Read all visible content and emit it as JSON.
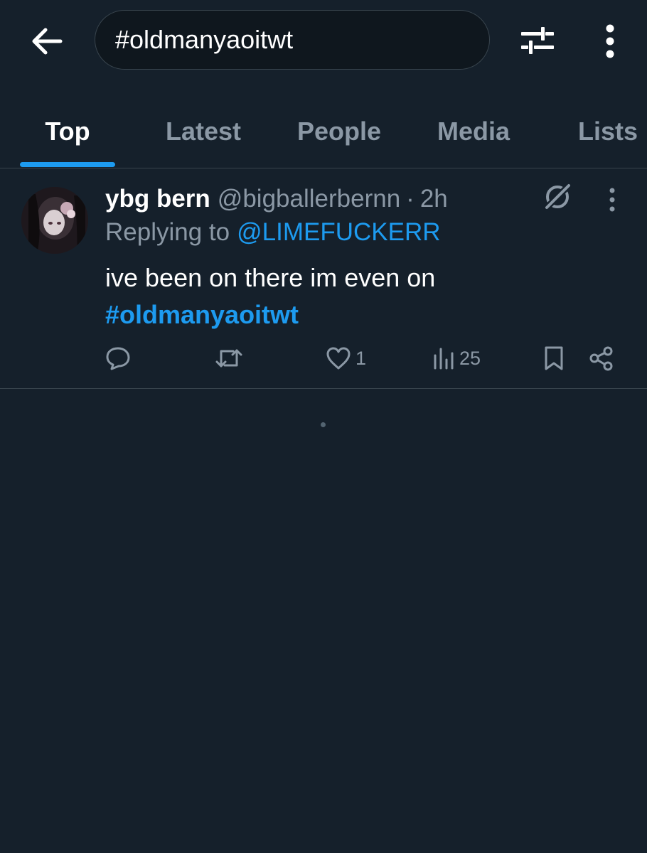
{
  "search": {
    "query": "#oldmanyaoitwt"
  },
  "tabs": [
    {
      "label": "Top"
    },
    {
      "label": "Latest"
    },
    {
      "label": "People"
    },
    {
      "label": "Media"
    },
    {
      "label": "Lists"
    }
  ],
  "active_tab": "Top",
  "tweet": {
    "display_name": "ybg bern",
    "handle": "@bigballerbernn",
    "separator": "·",
    "time": "2h",
    "reply_prefix": "Replying to",
    "reply_to": "@LIMEFUCKERR",
    "text": "ive been on there im even on",
    "hashtag": "#oldmanyaoitwt",
    "likes": "1",
    "views": "25"
  },
  "icons": {
    "back": "back-arrow-icon",
    "filter": "filter-sliders-icon",
    "more": "more-vertical-icon",
    "grok": "grok-icon",
    "reply": "reply-icon",
    "retweet": "retweet-icon",
    "like": "heart-icon",
    "views": "views-chart-icon",
    "bookmark": "bookmark-icon",
    "share": "share-icon"
  },
  "colors": {
    "background": "#15202b",
    "accent": "#1d9bf0",
    "muted_text": "#8b98a5",
    "border": "#38444d"
  }
}
